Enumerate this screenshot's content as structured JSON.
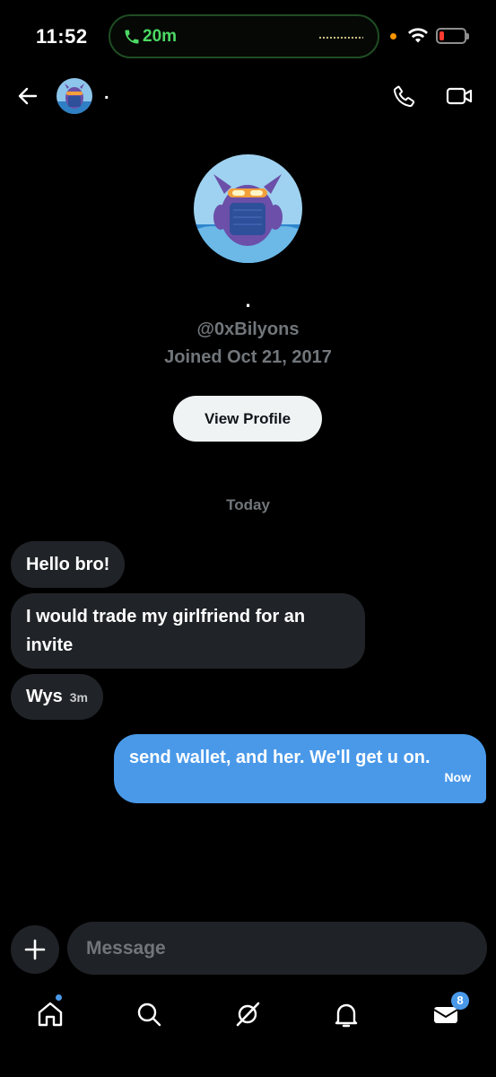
{
  "status_bar": {
    "time": "11:52",
    "call_duration": "20m",
    "call_color": "#4cd964"
  },
  "header": {
    "contact_name": ".",
    "back_icon": "arrow-left-icon",
    "call_icon": "phone-icon",
    "video_icon": "video-camera-icon"
  },
  "profile": {
    "display_name": ".",
    "handle": "@0xBilyons",
    "joined": "Joined Oct 21, 2017",
    "view_profile_label": "View Profile"
  },
  "conversation": {
    "date_separator": "Today",
    "messages": [
      {
        "direction": "incoming",
        "text": "Hello bro!"
      },
      {
        "direction": "incoming",
        "text": "I would trade my girlfriend for an invite"
      },
      {
        "direction": "incoming",
        "text": "Wys",
        "time": "3m"
      },
      {
        "direction": "outgoing",
        "text": "send wallet, and her. We'll get u on.",
        "time": "Now"
      }
    ]
  },
  "composer": {
    "placeholder": "Message",
    "add_icon": "plus-icon"
  },
  "tab_bar": {
    "items": [
      {
        "icon": "home-icon",
        "has_dot": true
      },
      {
        "icon": "search-icon"
      },
      {
        "icon": "grok-icon"
      },
      {
        "icon": "bell-icon"
      },
      {
        "icon": "mail-icon",
        "badge": "8"
      }
    ]
  },
  "colors": {
    "background": "#000000",
    "incoming_bubble": "#202327",
    "outgoing_bubble": "#4a99e9",
    "muted_text": "#71767b"
  }
}
